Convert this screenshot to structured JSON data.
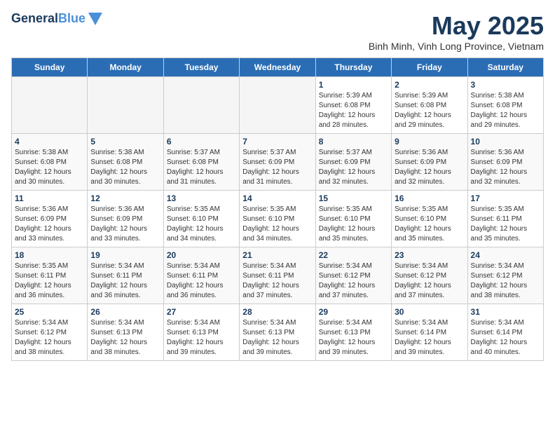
{
  "logo": {
    "text1": "General",
    "text2": "Blue"
  },
  "title": "May 2025",
  "subtitle": "Binh Minh, Vinh Long Province, Vietnam",
  "headers": [
    "Sunday",
    "Monday",
    "Tuesday",
    "Wednesday",
    "Thursday",
    "Friday",
    "Saturday"
  ],
  "weeks": [
    [
      {
        "day": "",
        "info": ""
      },
      {
        "day": "",
        "info": ""
      },
      {
        "day": "",
        "info": ""
      },
      {
        "day": "",
        "info": ""
      },
      {
        "day": "1",
        "info": "Sunrise: 5:39 AM\nSunset: 6:08 PM\nDaylight: 12 hours\nand 28 minutes."
      },
      {
        "day": "2",
        "info": "Sunrise: 5:39 AM\nSunset: 6:08 PM\nDaylight: 12 hours\nand 29 minutes."
      },
      {
        "day": "3",
        "info": "Sunrise: 5:38 AM\nSunset: 6:08 PM\nDaylight: 12 hours\nand 29 minutes."
      }
    ],
    [
      {
        "day": "4",
        "info": "Sunrise: 5:38 AM\nSunset: 6:08 PM\nDaylight: 12 hours\nand 30 minutes."
      },
      {
        "day": "5",
        "info": "Sunrise: 5:38 AM\nSunset: 6:08 PM\nDaylight: 12 hours\nand 30 minutes."
      },
      {
        "day": "6",
        "info": "Sunrise: 5:37 AM\nSunset: 6:08 PM\nDaylight: 12 hours\nand 31 minutes."
      },
      {
        "day": "7",
        "info": "Sunrise: 5:37 AM\nSunset: 6:09 PM\nDaylight: 12 hours\nand 31 minutes."
      },
      {
        "day": "8",
        "info": "Sunrise: 5:37 AM\nSunset: 6:09 PM\nDaylight: 12 hours\nand 32 minutes."
      },
      {
        "day": "9",
        "info": "Sunrise: 5:36 AM\nSunset: 6:09 PM\nDaylight: 12 hours\nand 32 minutes."
      },
      {
        "day": "10",
        "info": "Sunrise: 5:36 AM\nSunset: 6:09 PM\nDaylight: 12 hours\nand 32 minutes."
      }
    ],
    [
      {
        "day": "11",
        "info": "Sunrise: 5:36 AM\nSunset: 6:09 PM\nDaylight: 12 hours\nand 33 minutes."
      },
      {
        "day": "12",
        "info": "Sunrise: 5:36 AM\nSunset: 6:09 PM\nDaylight: 12 hours\nand 33 minutes."
      },
      {
        "day": "13",
        "info": "Sunrise: 5:35 AM\nSunset: 6:10 PM\nDaylight: 12 hours\nand 34 minutes."
      },
      {
        "day": "14",
        "info": "Sunrise: 5:35 AM\nSunset: 6:10 PM\nDaylight: 12 hours\nand 34 minutes."
      },
      {
        "day": "15",
        "info": "Sunrise: 5:35 AM\nSunset: 6:10 PM\nDaylight: 12 hours\nand 35 minutes."
      },
      {
        "day": "16",
        "info": "Sunrise: 5:35 AM\nSunset: 6:10 PM\nDaylight: 12 hours\nand 35 minutes."
      },
      {
        "day": "17",
        "info": "Sunrise: 5:35 AM\nSunset: 6:11 PM\nDaylight: 12 hours\nand 35 minutes."
      }
    ],
    [
      {
        "day": "18",
        "info": "Sunrise: 5:35 AM\nSunset: 6:11 PM\nDaylight: 12 hours\nand 36 minutes."
      },
      {
        "day": "19",
        "info": "Sunrise: 5:34 AM\nSunset: 6:11 PM\nDaylight: 12 hours\nand 36 minutes."
      },
      {
        "day": "20",
        "info": "Sunrise: 5:34 AM\nSunset: 6:11 PM\nDaylight: 12 hours\nand 36 minutes."
      },
      {
        "day": "21",
        "info": "Sunrise: 5:34 AM\nSunset: 6:11 PM\nDaylight: 12 hours\nand 37 minutes."
      },
      {
        "day": "22",
        "info": "Sunrise: 5:34 AM\nSunset: 6:12 PM\nDaylight: 12 hours\nand 37 minutes."
      },
      {
        "day": "23",
        "info": "Sunrise: 5:34 AM\nSunset: 6:12 PM\nDaylight: 12 hours\nand 37 minutes."
      },
      {
        "day": "24",
        "info": "Sunrise: 5:34 AM\nSunset: 6:12 PM\nDaylight: 12 hours\nand 38 minutes."
      }
    ],
    [
      {
        "day": "25",
        "info": "Sunrise: 5:34 AM\nSunset: 6:12 PM\nDaylight: 12 hours\nand 38 minutes."
      },
      {
        "day": "26",
        "info": "Sunrise: 5:34 AM\nSunset: 6:13 PM\nDaylight: 12 hours\nand 38 minutes."
      },
      {
        "day": "27",
        "info": "Sunrise: 5:34 AM\nSunset: 6:13 PM\nDaylight: 12 hours\nand 39 minutes."
      },
      {
        "day": "28",
        "info": "Sunrise: 5:34 AM\nSunset: 6:13 PM\nDaylight: 12 hours\nand 39 minutes."
      },
      {
        "day": "29",
        "info": "Sunrise: 5:34 AM\nSunset: 6:13 PM\nDaylight: 12 hours\nand 39 minutes."
      },
      {
        "day": "30",
        "info": "Sunrise: 5:34 AM\nSunset: 6:14 PM\nDaylight: 12 hours\nand 39 minutes."
      },
      {
        "day": "31",
        "info": "Sunrise: 5:34 AM\nSunset: 6:14 PM\nDaylight: 12 hours\nand 40 minutes."
      }
    ]
  ]
}
